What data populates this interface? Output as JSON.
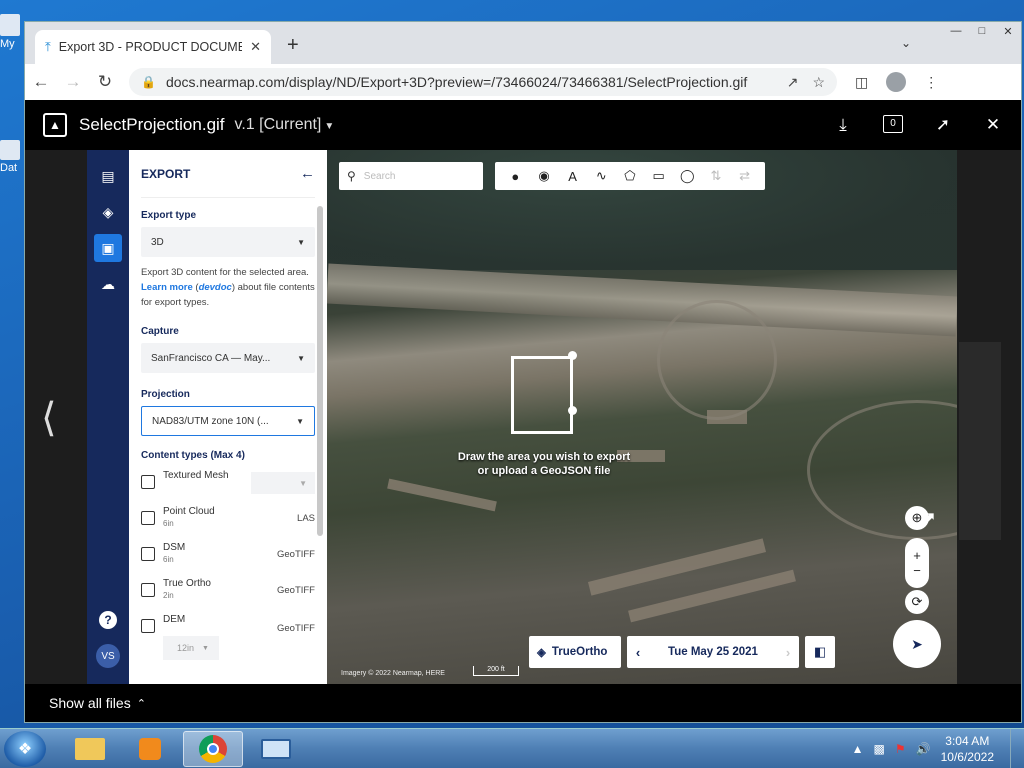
{
  "desktop": {
    "icon_labels": [
      "My",
      "Dat"
    ]
  },
  "browser": {
    "tab_title": "Export 3D - PRODUCT DOCUMEN",
    "url": "docs.nearmap.com/display/ND/Export+3D?preview=/73466024/73466381/SelectProjection.gif"
  },
  "viewer": {
    "file_name": "SelectProjection.gif",
    "version": "v.1 [Current]",
    "comment_count": "0",
    "footer_label": "Show all files"
  },
  "app": {
    "rail_icons": [
      "map-icon",
      "layers-icon",
      "image-icon",
      "cloud-download-icon"
    ],
    "help": "?",
    "user_initials": "VS",
    "panel": {
      "title": "EXPORT",
      "export_type_label": "Export type",
      "export_type_value": "3D",
      "desc_before": "Export 3D content for the selected area.",
      "desc_link1": "Learn more",
      "desc_paren_open": "(",
      "desc_link2": "devdoc",
      "desc_after": ") about file contents for export types.",
      "capture_label": "Capture",
      "capture_value": "SanFrancisco CA — May...",
      "projection_label": "Projection",
      "projection_value": "NAD83/UTM zone 10N (...",
      "content_types_label": "Content types (Max 4)",
      "content_types": [
        {
          "name": "Textured Mesh",
          "res": "",
          "format": ""
        },
        {
          "name": "Point Cloud",
          "res": "6in",
          "format": "LAS"
        },
        {
          "name": "DSM",
          "res": "6in",
          "format": "GeoTIFF"
        },
        {
          "name": "True Ortho",
          "res": "2in",
          "format": "GeoTIFF"
        },
        {
          "name": "DEM",
          "res": "",
          "format": "GeoTIFF"
        }
      ],
      "dem_res_value": "12in"
    },
    "map": {
      "search_placeholder": "Search",
      "draw_message_line1": "Draw the area you wish to export",
      "draw_message_line2": "or upload a GeoJSON file",
      "true_ortho_label": "TrueOrtho",
      "date": "Tue May 25 2021",
      "attribution": "Imagery © 2022 Nearmap, HERE",
      "scale": "200 ft"
    }
  },
  "taskbar": {
    "time": "3:04 AM",
    "date": "10/6/2022"
  },
  "colors": {
    "nearmap_navy": "#16295c",
    "accent_blue": "#1f78e0"
  }
}
